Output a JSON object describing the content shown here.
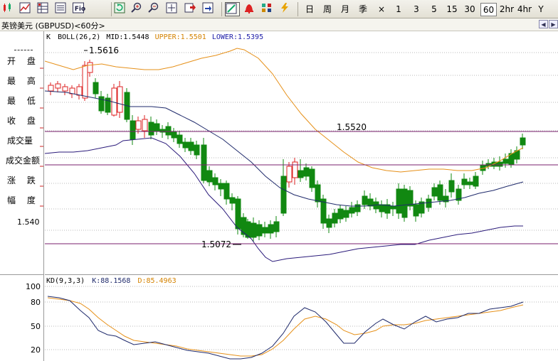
{
  "toolbar": {
    "icons": [
      "candlestick-chart-icon",
      "line-chart-icon",
      "quote-grid-icon",
      "info-list-icon",
      "fio-report-icon",
      "refresh-icon",
      "zoom-in-icon",
      "zoom-out-icon",
      "crosshair-cursor-icon",
      "export-icon",
      "save-icon",
      "draw-tool-icon",
      "alarm-bell-icon",
      "indicator-icon",
      "lightning-icon"
    ],
    "fio_label": "Fio",
    "periods": [
      "日",
      "周",
      "月",
      "季",
      "×",
      "1",
      "3",
      "5",
      "15",
      "30",
      "60",
      "2hr",
      "4hr",
      "Y"
    ],
    "selected_period": "60"
  },
  "tab": {
    "title": "英镑美元 (GBPUSD)<60分>"
  },
  "left_panel": {
    "labels": [
      "开 盘",
      "最 高",
      "最 低",
      "收 盘",
      "成交量",
      "成交金额",
      "涨 跌",
      "幅 度"
    ],
    "price_tick": "1.540"
  },
  "indicator": {
    "k_label": "K",
    "boll_name": "BOLL(26,2)",
    "mid_label": "MID:1.5448",
    "upper_label": "UPPER:1.5501",
    "lower_label": "LOWER:1.5395",
    "colors": {
      "upper": "#e69019",
      "mid": "#1f2a6b",
      "lower": "#2a1a7a",
      "mid_text": "#000000",
      "upper_text": "#d48200",
      "lower_text": "#2222aa"
    }
  },
  "annotations": {
    "high": "1.5616",
    "line": "1.5520",
    "low": "1.5072"
  },
  "kd": {
    "header_name": "KD(9,3,3)",
    "k_label": "K:88.1568",
    "d_label": "D:85.4963",
    "ticks": [
      "100",
      "80",
      "50",
      "20"
    ],
    "colors": {
      "k": "#1f2a6b",
      "d": "#e69019"
    }
  },
  "colors": {
    "up": "#dd2222",
    "down": "#118811",
    "hline": "#7a1f6e"
  }
}
